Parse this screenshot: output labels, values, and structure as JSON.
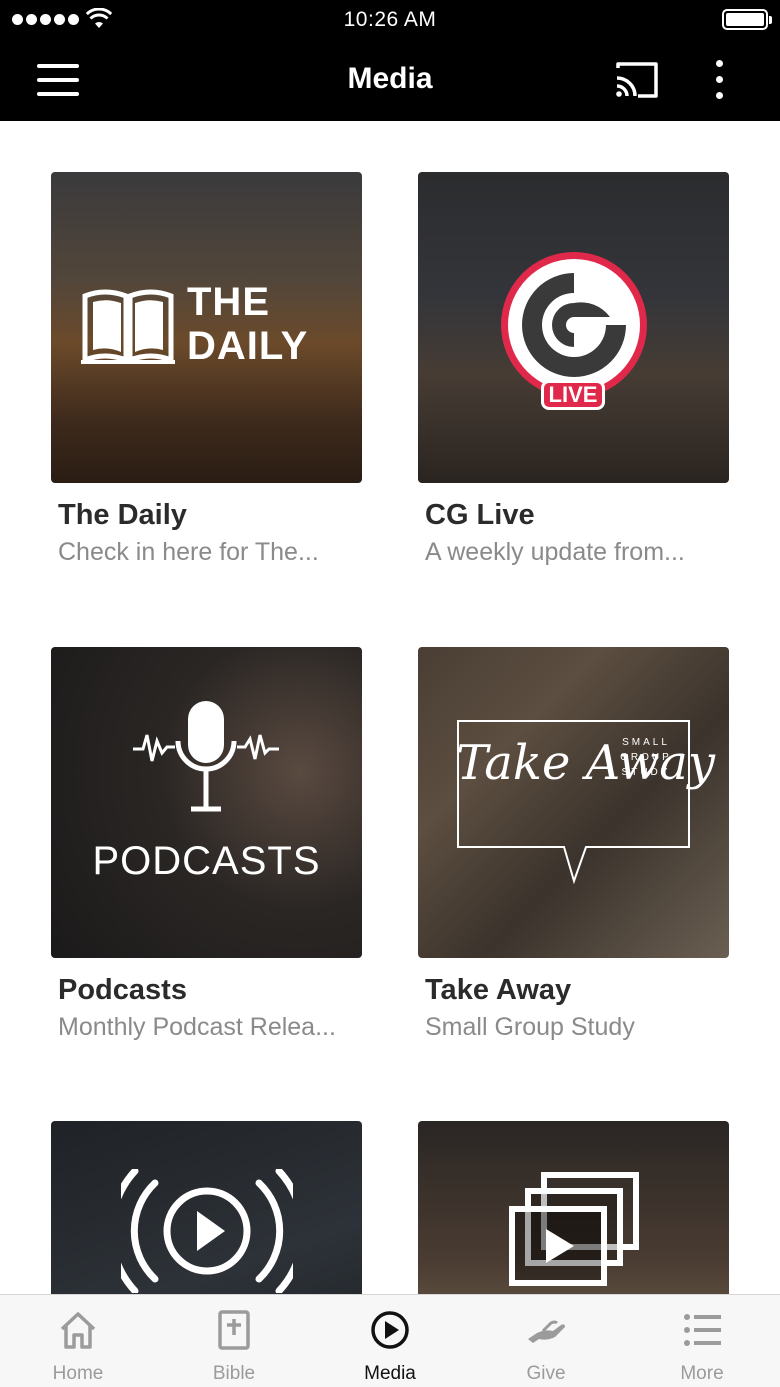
{
  "status_bar": {
    "time": "10:26 AM"
  },
  "nav": {
    "title": "Media"
  },
  "cards": [
    {
      "title": "The Daily",
      "subtitle": "Check in here for The...",
      "art_line1": "THE",
      "art_line2": "DAILY"
    },
    {
      "title": "CG Live",
      "subtitle": "A weekly update from...",
      "badge": "LIVE"
    },
    {
      "title": "Podcasts",
      "subtitle": "Monthly Podcast Relea...",
      "art_text": "PODCASTS"
    },
    {
      "title": "Take Away",
      "subtitle": "Small Group Study",
      "art_small": "SMALL GROUP STUDY",
      "art_script": "Take Away"
    }
  ],
  "tabs": [
    {
      "label": "Home",
      "icon": "home-icon",
      "active": false
    },
    {
      "label": "Bible",
      "icon": "bible-icon",
      "active": false
    },
    {
      "label": "Media",
      "icon": "play-circle-icon",
      "active": true
    },
    {
      "label": "Give",
      "icon": "give-icon",
      "active": false
    },
    {
      "label": "More",
      "icon": "list-icon",
      "active": false
    }
  ],
  "colors": {
    "nav_bg": "#000000",
    "live_red": "#e0284a",
    "tab_inactive": "#9b9b9b",
    "tab_active": "#111111"
  }
}
